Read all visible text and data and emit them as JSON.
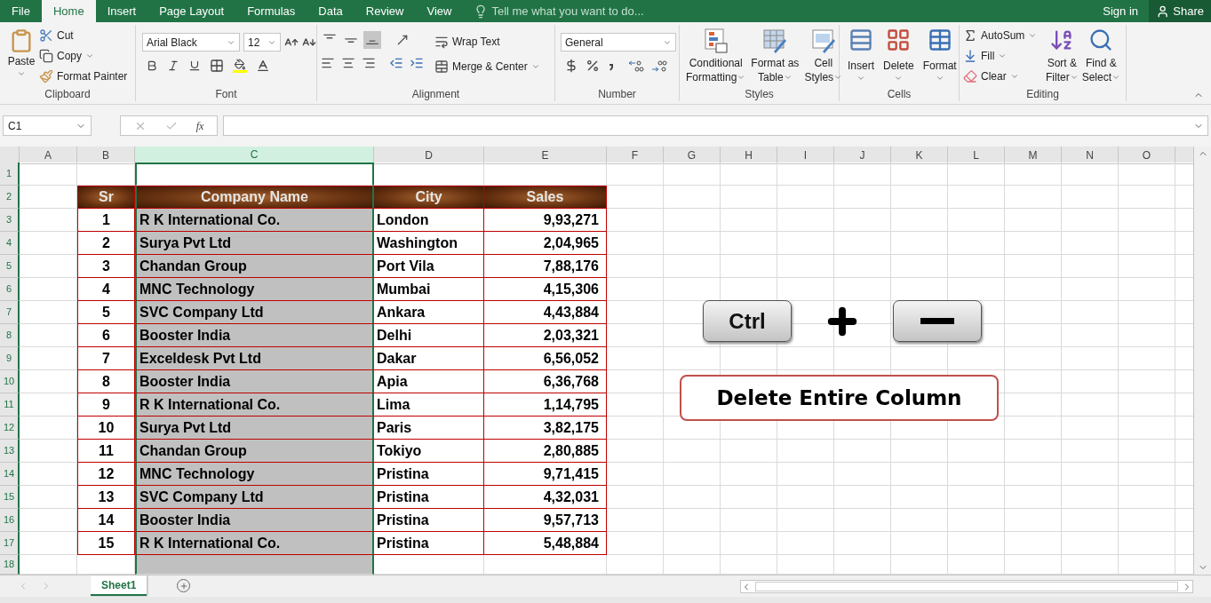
{
  "menu_tabs": [
    {
      "label": "File",
      "selected": false
    },
    {
      "label": "Home",
      "selected": true
    },
    {
      "label": "Insert",
      "selected": false
    },
    {
      "label": "Page Layout",
      "selected": false
    },
    {
      "label": "Formulas",
      "selected": false
    },
    {
      "label": "Data",
      "selected": false
    },
    {
      "label": "Review",
      "selected": false
    },
    {
      "label": "View",
      "selected": false
    }
  ],
  "tell_me": "Tell me what you want to do...",
  "sign_in": "Sign in",
  "share": "Share",
  "clipboard": {
    "label": "Clipboard",
    "paste": "Paste",
    "cut": "Cut",
    "copy": "Copy",
    "format_painter": "Format Painter"
  },
  "font": {
    "label": "Font",
    "font_name": "Arial Black",
    "font_size": "12"
  },
  "alignment": {
    "label": "Alignment",
    "wrap_text": "Wrap Text",
    "merge_center": "Merge & Center",
    "vertical": [
      {
        "kind": "top",
        "selected": false
      },
      {
        "kind": "middle",
        "selected": false
      },
      {
        "kind": "bottom",
        "selected": true
      }
    ]
  },
  "number": {
    "label": "Number",
    "format": "General"
  },
  "styles": {
    "label": "Styles",
    "buttons": [
      {
        "kind": "conditional",
        "line1": "Conditional",
        "line2": "Formatting"
      },
      {
        "kind": "table",
        "line1": "Format as",
        "line2": "Table"
      },
      {
        "kind": "cell",
        "line1": "Cell",
        "line2": "Styles"
      }
    ]
  },
  "cells": {
    "label": "Cells",
    "buttons": [
      {
        "kind": "insert",
        "label": "Insert"
      },
      {
        "kind": "delete",
        "label": "Delete"
      },
      {
        "kind": "format",
        "label": "Format"
      }
    ]
  },
  "editing": {
    "label": "Editing",
    "autosum": "AutoSum",
    "fill": "Fill",
    "clear": "Clear",
    "sort": {
      "line1": "Sort &",
      "line2": "Filter"
    },
    "find": {
      "line1": "Find &",
      "line2": "Select"
    }
  },
  "formula_bar": {
    "name_box": "C1",
    "fx": "fx"
  },
  "columns": [
    {
      "label": "A",
      "selected": false
    },
    {
      "label": "B",
      "selected": false
    },
    {
      "label": "C",
      "selected": true
    },
    {
      "label": "D",
      "selected": false
    },
    {
      "label": "E",
      "selected": false
    },
    {
      "label": "F",
      "selected": false
    },
    {
      "label": "G",
      "selected": false
    },
    {
      "label": "H",
      "selected": false
    },
    {
      "label": "I",
      "selected": false
    },
    {
      "label": "J",
      "selected": false
    },
    {
      "label": "K",
      "selected": false
    },
    {
      "label": "L",
      "selected": false
    },
    {
      "label": "M",
      "selected": false
    },
    {
      "label": "N",
      "selected": false
    },
    {
      "label": "O",
      "selected": false
    }
  ],
  "row_numbers": [
    "1",
    "2",
    "3",
    "4",
    "5",
    "6",
    "7",
    "8",
    "9",
    "10",
    "11",
    "12",
    "13",
    "14",
    "15",
    "16",
    "17",
    "18"
  ],
  "table": {
    "header": [
      "Sr",
      "Company Name",
      "City",
      "Sales"
    ],
    "rows": [
      [
        "1",
        "R K International Co.",
        "London",
        "9,93,271"
      ],
      [
        "2",
        "Surya Pvt Ltd",
        "Washington",
        "2,04,965"
      ],
      [
        "3",
        "Chandan Group",
        "Port Vila",
        "7,88,176"
      ],
      [
        "4",
        "MNC Technology",
        "Mumbai",
        "4,15,306"
      ],
      [
        "5",
        "SVC Company Ltd",
        "Ankara",
        "4,43,884"
      ],
      [
        "6",
        "Booster India",
        "Delhi",
        "2,03,321"
      ],
      [
        "7",
        "Exceldesk Pvt Ltd",
        "Dakar",
        "6,56,052"
      ],
      [
        "8",
        "Booster India",
        "Apia",
        "6,36,768"
      ],
      [
        "9",
        "R K International Co.",
        "Lima",
        "1,14,795"
      ],
      [
        "10",
        "Surya Pvt Ltd",
        "Paris",
        "3,82,175"
      ],
      [
        "11",
        "Chandan Group",
        "Tokiyo",
        "2,80,885"
      ],
      [
        "12",
        "MNC Technology",
        "Pristina",
        "9,71,415"
      ],
      [
        "13",
        "SVC Company Ltd",
        "Pristina",
        "4,32,031"
      ],
      [
        "14",
        "Booster India",
        "Pristina",
        "9,57,713"
      ],
      [
        "15",
        "R K International Co.",
        "Pristina",
        "5,48,884"
      ]
    ]
  },
  "shortcut": {
    "key": "Ctrl",
    "caption": "Delete Entire Column"
  },
  "sheet_tabs": [
    {
      "label": "Sheet1",
      "selected": true
    }
  ]
}
